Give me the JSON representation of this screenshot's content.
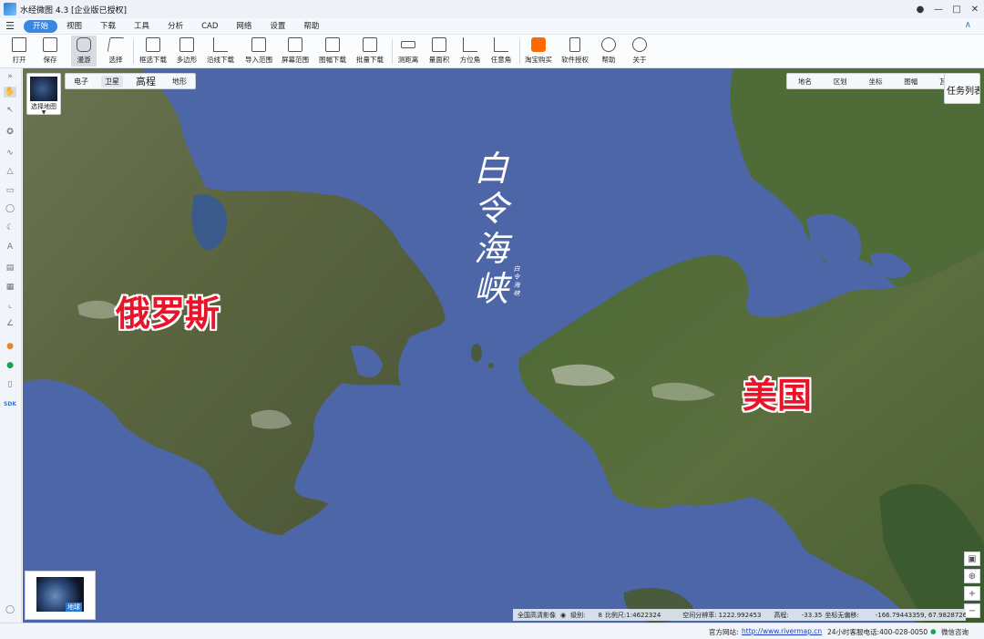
{
  "window": {
    "title": "水经微图 4.3 [企业版已授权]",
    "controls": [
      "person-icon",
      "minimize-icon",
      "maximize-icon",
      "close-icon"
    ]
  },
  "menu": {
    "items": [
      {
        "label": "开始",
        "active": true
      },
      {
        "label": "视图"
      },
      {
        "label": "下载"
      },
      {
        "label": "工具"
      },
      {
        "label": "分析"
      },
      {
        "label": "CAD"
      },
      {
        "label": "网络"
      },
      {
        "label": "设置"
      },
      {
        "label": "帮助"
      }
    ]
  },
  "ribbon": {
    "tools": [
      {
        "label": "打开",
        "icon": "folder-icon"
      },
      {
        "label": "保存",
        "icon": "save-icon"
      },
      {
        "label": "漫游",
        "icon": "hand-icon",
        "pressed": true
      },
      {
        "label": "选择",
        "icon": "cursor-icon"
      },
      {
        "label": "框选下载",
        "icon": "box-download-icon"
      },
      {
        "label": "多边形",
        "icon": "polygon-download-icon"
      },
      {
        "label": "沿线下载",
        "icon": "line-download-icon"
      },
      {
        "label": "导入范围",
        "icon": "import-range-icon"
      },
      {
        "label": "屏幕范围",
        "icon": "screen-range-icon"
      },
      {
        "label": "图幅下载",
        "icon": "sheet-download-icon"
      },
      {
        "label": "批量下载",
        "icon": "batch-download-icon"
      },
      {
        "label": "测距离",
        "icon": "measure-distance-icon"
      },
      {
        "label": "量面积",
        "icon": "measure-area-icon"
      },
      {
        "label": "方位角",
        "icon": "azimuth-icon"
      },
      {
        "label": "任意角",
        "icon": "angle-icon"
      },
      {
        "label": "淘宝购买",
        "icon": "taobao-icon"
      },
      {
        "label": "软件授权",
        "icon": "lock-icon"
      },
      {
        "label": "帮助",
        "icon": "help-icon"
      },
      {
        "label": "关于",
        "icon": "info-icon"
      }
    ]
  },
  "map": {
    "layer_switch_label": "选择地图",
    "map_types": [
      "电子",
      "卫星",
      "高程",
      "地形"
    ],
    "active_map_type": "卫星",
    "overlays": [
      "地名",
      "区划",
      "坐标",
      "图幅",
      "瓦片"
    ],
    "task_list_label": "任务列表",
    "labels": {
      "strait": "白令海峡",
      "strait_small": "白令海峡",
      "russia": "俄罗斯",
      "usa": "美国"
    },
    "globe_label": "地球",
    "colors": {
      "sea": "#4d66a8",
      "label_red": "#e8152a"
    }
  },
  "coords": {
    "source": "全国高清影像",
    "level_label": "级别:",
    "level": "8",
    "scale_label": "比例尺:",
    "scale": "1:4622324",
    "resolution_label": "空间分辨率:",
    "resolution": "1222.992453",
    "elevation_label": "高程:",
    "elevation": "-33.35",
    "offset_label": "坐标无偏移:",
    "lonlat": "-166.79443359, 67.98287262"
  },
  "status": {
    "site_label": "官方网站:",
    "site_url": "http://www.rivermap.cn",
    "hotline": "24小时客服电话:400-028-0050",
    "wechat": "微信咨询"
  }
}
